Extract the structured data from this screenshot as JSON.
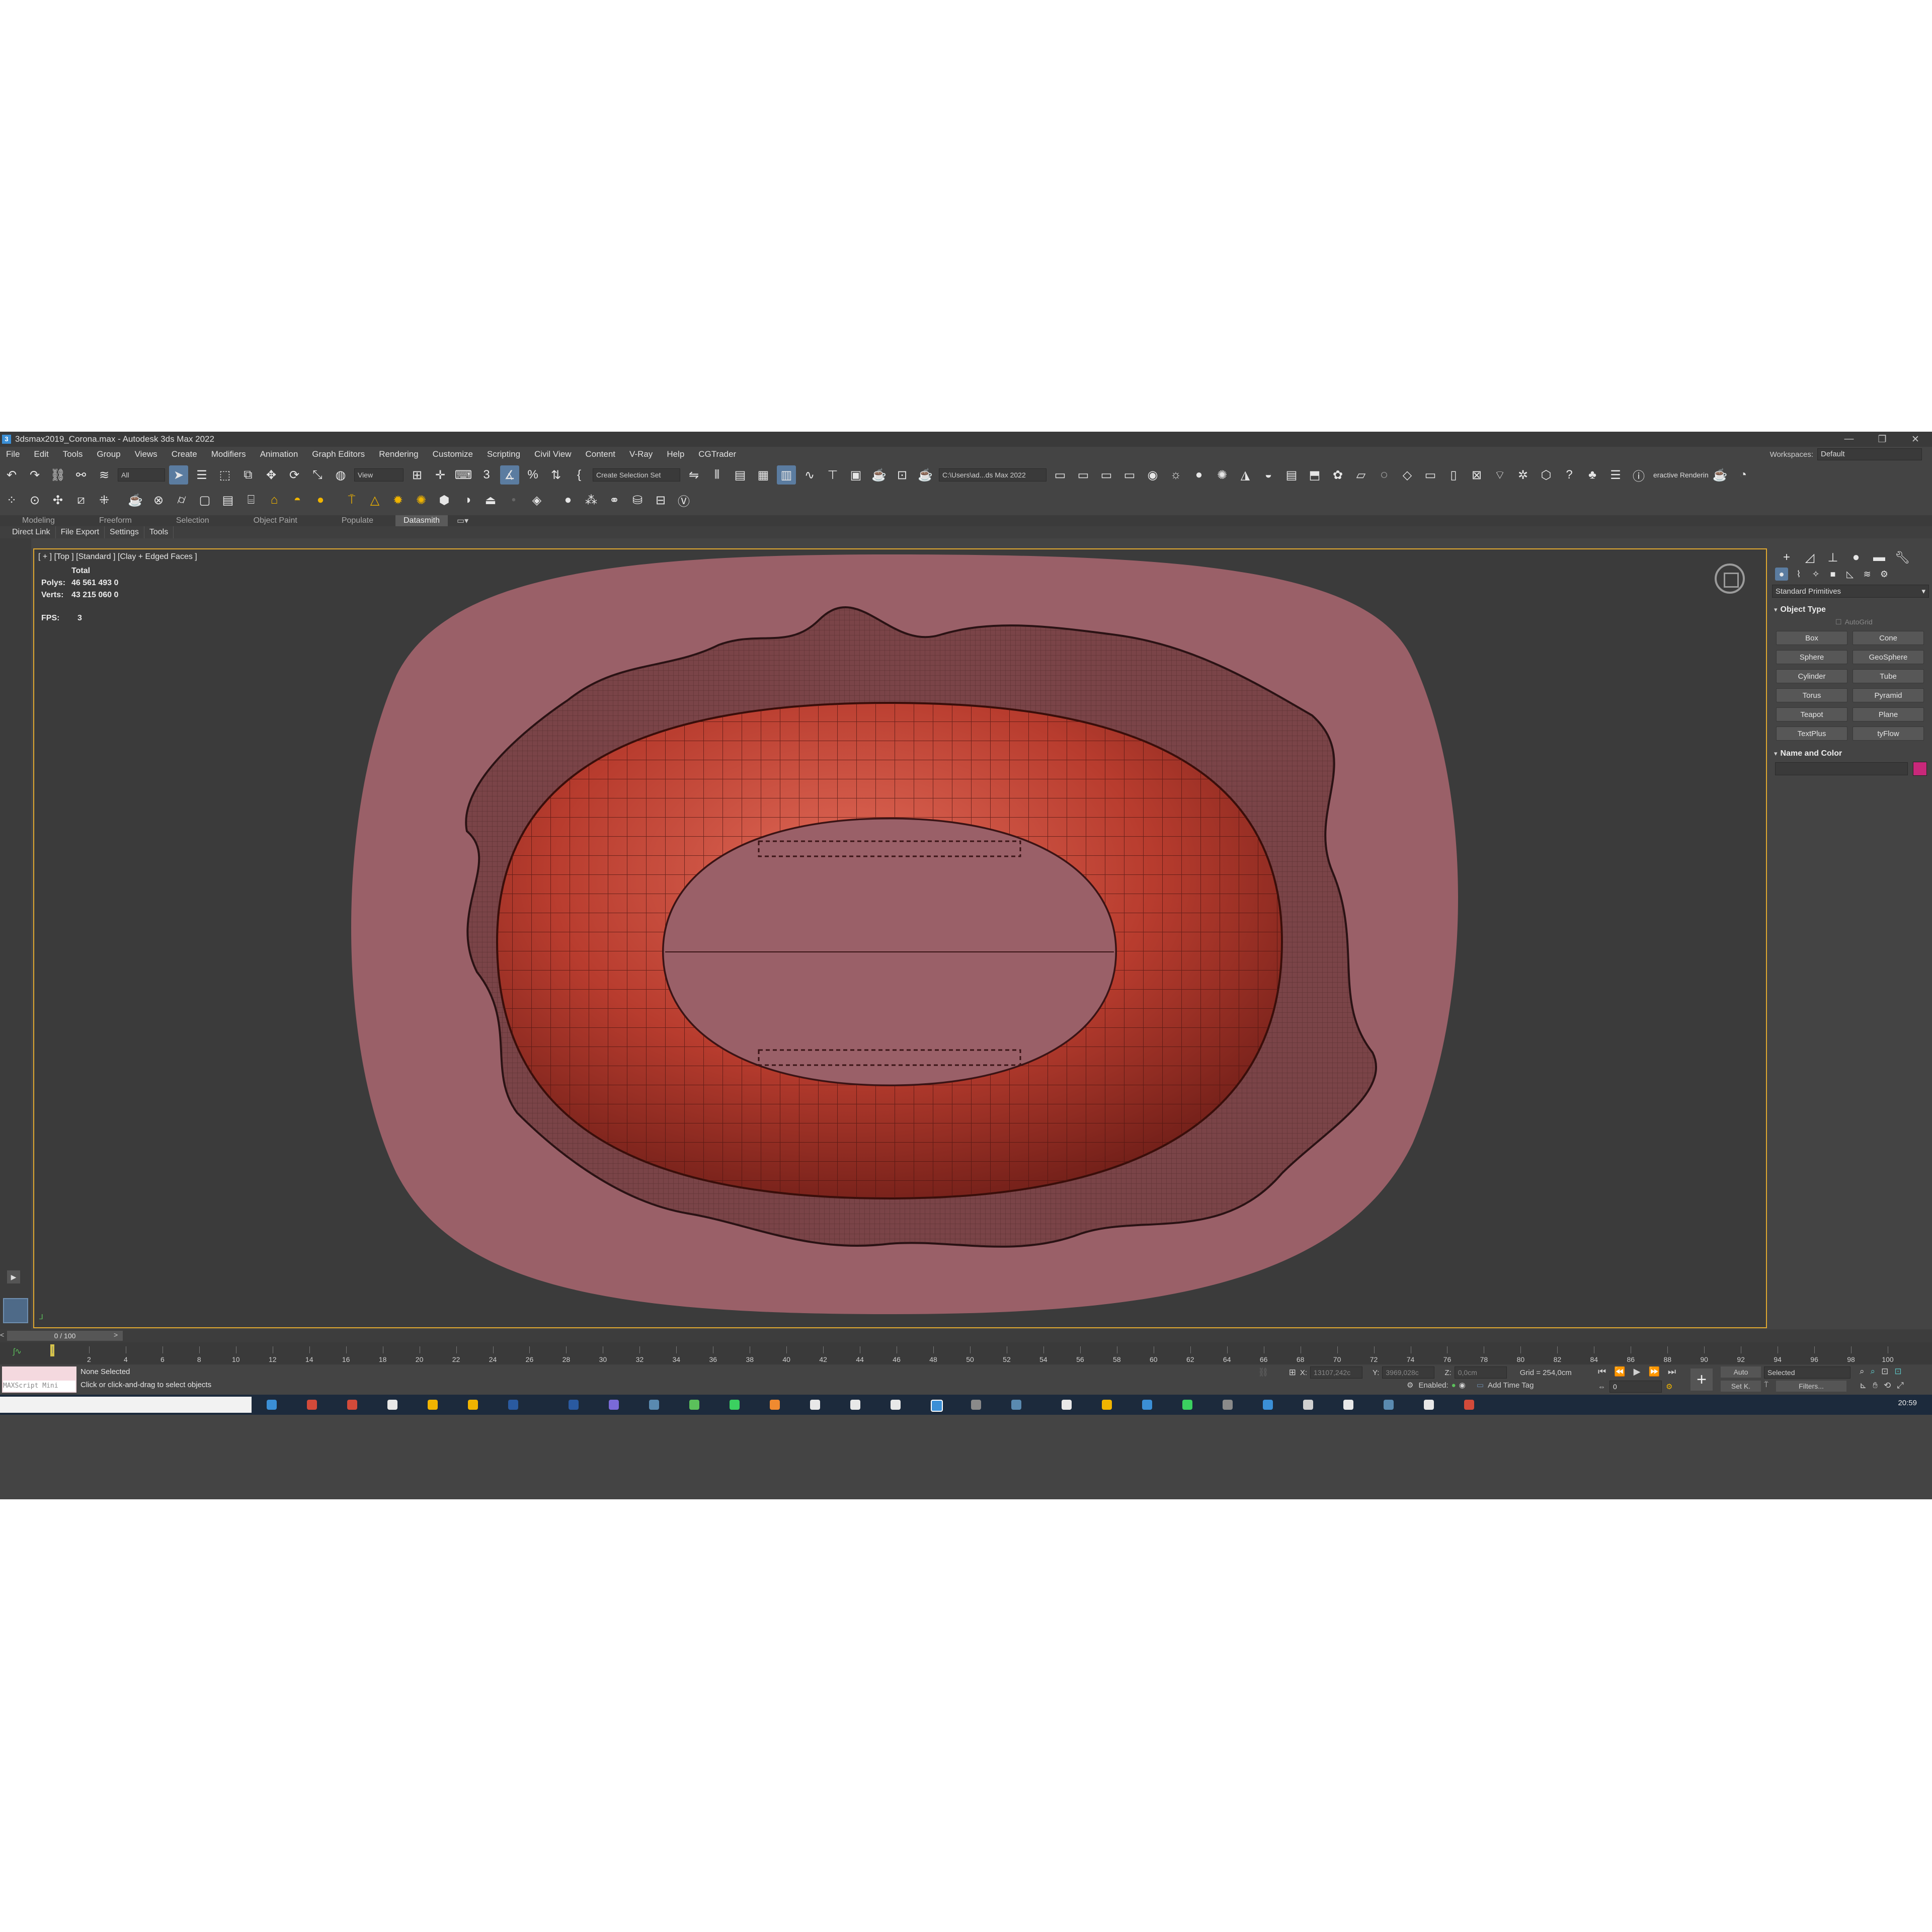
{
  "window": {
    "title": "3dsmax2019_Corona.max - Autodesk 3ds Max 2022",
    "minimize": "—",
    "restore": "❐",
    "close": "✕"
  },
  "menu": [
    "File",
    "Edit",
    "Tools",
    "Group",
    "Views",
    "Create",
    "Modifiers",
    "Animation",
    "Graph Editors",
    "Rendering",
    "Customize",
    "Scripting",
    "Civil View",
    "Content",
    "V-Ray",
    "Help",
    "CGTrader"
  ],
  "workspace": {
    "label": "Workspaces:",
    "value": "Default"
  },
  "toolbar1": {
    "filter_value": "All",
    "refcoord_value": "View",
    "selection_set_placeholder": "Create Selection Set",
    "project_path": "C:\\Users\\ad...ds Max 2022",
    "render_label": "eractive Renderin"
  },
  "ribbon_tabs": [
    "Modeling",
    "Freeform",
    "Selection",
    "Object Paint",
    "Populate",
    "Datasmith"
  ],
  "ribbon_active": "Datasmith",
  "datasmith_tabs": [
    "Direct Link",
    "File Export",
    "Settings",
    "Tools"
  ],
  "viewport": {
    "label": "[ + ] [Top ] [Standard ] [Clay + Edged Faces ]",
    "stats_header": "Total",
    "polys_label": "Polys:",
    "polys_value": "46 561 493 0",
    "verts_label": "Verts:",
    "verts_value": "43 215 060 0",
    "fps_label": "FPS:",
    "fps_value": "3"
  },
  "command_panel": {
    "category": "Standard Primitives",
    "object_type_header": "Object Type",
    "autogrid": "AutoGrid",
    "buttons": [
      "Box",
      "Cone",
      "Sphere",
      "GeoSphere",
      "Cylinder",
      "Tube",
      "Torus",
      "Pyramid",
      "Teapot",
      "Plane",
      "TextPlus",
      "tyFlow"
    ],
    "name_color_header": "Name and Color",
    "color_swatch": "#c8287a"
  },
  "timeline": {
    "slider_text": "0 / 100",
    "ticks": [
      "0",
      "2",
      "4",
      "6",
      "8",
      "10",
      "12",
      "14",
      "16",
      "18",
      "20",
      "22",
      "24",
      "26",
      "28",
      "30",
      "32",
      "34",
      "36",
      "38",
      "40",
      "42",
      "44",
      "46",
      "48",
      "50",
      "52",
      "54",
      "56",
      "58",
      "60",
      "62",
      "64",
      "66",
      "68",
      "70",
      "72",
      "74",
      "76",
      "78",
      "80",
      "82",
      "84",
      "86",
      "88",
      "90",
      "92",
      "94",
      "96",
      "98",
      "100"
    ]
  },
  "status": {
    "selection": "None Selected",
    "prompt": "Click or click-and-drag to select objects",
    "maxscript": "MAXScript Mini",
    "x_label": "X:",
    "x_value": "13107,242c",
    "y_label": "Y:",
    "y_value": "3969,028c",
    "z_label": "Z:",
    "z_value": "0,0cm",
    "grid": "Grid = 254,0cm",
    "enabled": "Enabled:",
    "add_time_tag": "Add Time Tag",
    "auto_btn": "Auto",
    "setk_btn": "Set K.",
    "selected_dd": "Selected",
    "filters_btn": "Filters...",
    "frame_value": "0"
  },
  "taskbar": {
    "clock": "20:59"
  },
  "colors": {
    "accent_active": "#5b7ca0",
    "viewport_border": "#e0a830",
    "ground": "#9a6068",
    "torus": "#c94a3a"
  }
}
